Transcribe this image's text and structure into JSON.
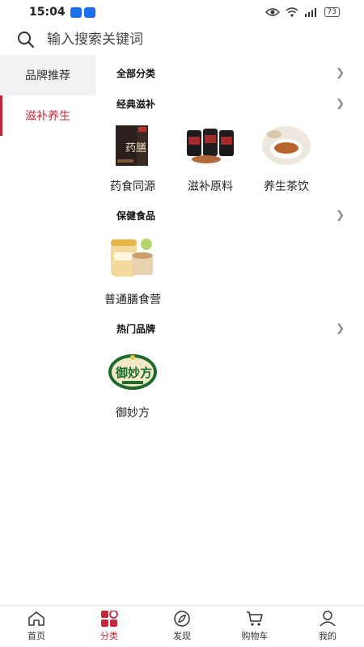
{
  "status": {
    "time": "15:04",
    "battery": "73"
  },
  "search": {
    "placeholder": "输入搜索关键词"
  },
  "sidebar": {
    "items": [
      {
        "label": "品牌推荐"
      },
      {
        "label": "滋补养生"
      }
    ]
  },
  "sections": [
    {
      "title": "全部分类"
    },
    {
      "title": "经典滋补",
      "items": [
        {
          "label": "药食同源"
        },
        {
          "label": "滋补原料"
        },
        {
          "label": "养生茶饮"
        }
      ]
    },
    {
      "title": "保健食品",
      "items": [
        {
          "label": "普通膳食营"
        }
      ]
    },
    {
      "title": "热门品牌",
      "items": [
        {
          "label": "御妙方"
        }
      ]
    }
  ],
  "tabbar": {
    "items": [
      {
        "label": "首页",
        "icon": "home-icon"
      },
      {
        "label": "分类",
        "icon": "category-icon"
      },
      {
        "label": "发现",
        "icon": "discover-icon"
      },
      {
        "label": "购物车",
        "icon": "cart-icon"
      },
      {
        "label": "我的",
        "icon": "user-icon"
      }
    ]
  },
  "colors": {
    "accent": "#c5283d"
  },
  "product_image_text": {
    "yaoshan_box": "药膳",
    "brand_logo": "御妙方"
  }
}
